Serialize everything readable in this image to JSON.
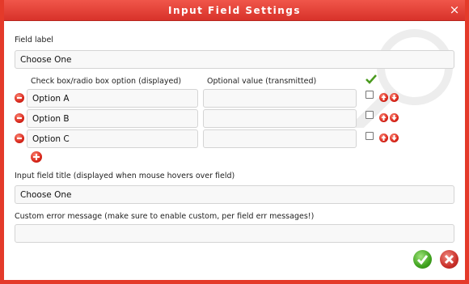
{
  "window": {
    "title": "Input Field Settings"
  },
  "field_label": {
    "label": "Field label",
    "value": "Choose One"
  },
  "options_table": {
    "col_option": "Check box/radio box option (displayed)",
    "col_value": "Optional value (transmitted)",
    "rows": [
      {
        "option": "Option A",
        "value": "",
        "checked": false
      },
      {
        "option": "Option B",
        "value": "",
        "checked": false
      },
      {
        "option": "Option C",
        "value": "",
        "checked": false
      }
    ]
  },
  "input_title": {
    "label": "Input field title (displayed when mouse hovers over field)",
    "value": "Choose One"
  },
  "error_message": {
    "label": "Custom error message (make sure to enable custom, per field err messages!)",
    "value": ""
  },
  "icons": {
    "close": "close-icon",
    "remove": "minus-circle-icon",
    "add": "plus-circle-icon",
    "move_up": "arrow-up-icon",
    "move_down": "arrow-down-icon",
    "default_check": "checkmark-icon",
    "ok": "checkmark-circle-icon",
    "cancel": "x-circle-icon"
  },
  "colors": {
    "accent": "#e43a2a",
    "ok": "#3fa21e",
    "cancel": "#c9302a"
  }
}
